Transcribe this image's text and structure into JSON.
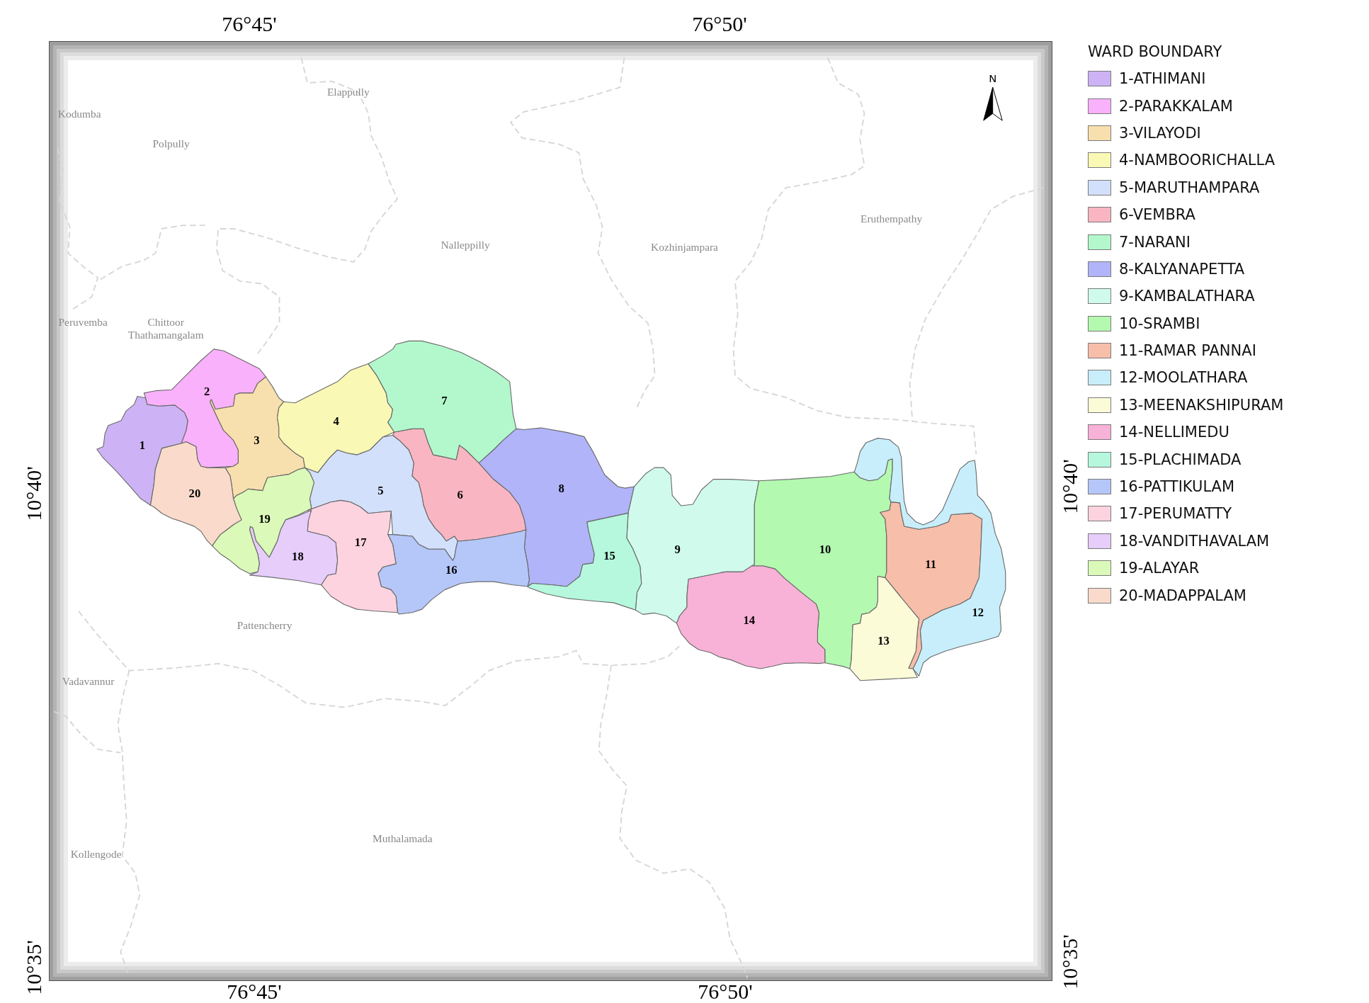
{
  "coordinates": {
    "top": [
      "76°45'",
      "76°50'"
    ],
    "bottom": [
      "76°45'",
      "76°50'"
    ],
    "left": [
      "10°40'",
      "10°35'"
    ],
    "right": [
      "10°40'",
      "10°35'"
    ]
  },
  "map": {
    "places": [
      "Kodumba",
      "Polpully",
      "Elappully",
      "Nalleppilly",
      "Kozhinjampara",
      "Eruthempathy",
      "Peruvemba",
      "Chittoor Thathamangalam",
      "Pattencherry",
      "Vadavannur",
      "Kollengode",
      "Muthalamada"
    ],
    "north_arrow": {
      "label": "N"
    },
    "wards": [
      {
        "label": "1",
        "color": "#cdb3f5"
      },
      {
        "label": "2",
        "color": "#f9b1fb"
      },
      {
        "label": "3",
        "color": "#f8dfae"
      },
      {
        "label": "4",
        "color": "#faf8b5"
      },
      {
        "label": "5",
        "color": "#d3e0fb"
      },
      {
        "label": "6",
        "color": "#f9b6c2"
      },
      {
        "label": "7",
        "color": "#b3f8cc"
      },
      {
        "label": "8",
        "color": "#b1b4f9"
      },
      {
        "label": "9",
        "color": "#d0fbec"
      },
      {
        "label": "10",
        "color": "#b3f9b0"
      },
      {
        "label": "11",
        "color": "#f7beaa"
      },
      {
        "label": "12",
        "color": "#c8eefb"
      },
      {
        "label": "13",
        "color": "#fcfbd8"
      },
      {
        "label": "14",
        "color": "#f8b1d7"
      },
      {
        "label": "15",
        "color": "#b5f8dd"
      },
      {
        "label": "16",
        "color": "#b5c6f8"
      },
      {
        "label": "17",
        "color": "#fcd3df"
      },
      {
        "label": "18",
        "color": "#e6cdfa"
      },
      {
        "label": "19",
        "color": "#dbf9b8"
      },
      {
        "label": "20",
        "color": "#f9dacb"
      }
    ]
  },
  "legend": {
    "title": "WARD BOUNDARY",
    "items": [
      {
        "label": "1-ATHIMANI",
        "color": "#cdb3f5"
      },
      {
        "label": "2-PARAKKALAM",
        "color": "#f9b1fb"
      },
      {
        "label": "3-VILAYODI",
        "color": "#f8dfae"
      },
      {
        "label": "4-NAMBOORICHALLA",
        "color": "#faf8b5"
      },
      {
        "label": "5-MARUTHAMPARA",
        "color": "#d3e0fb"
      },
      {
        "label": "6-VEMBRA",
        "color": "#f9b6c2"
      },
      {
        "label": "7-NARANI",
        "color": "#b3f8cc"
      },
      {
        "label": "8-KALYANAPETTA",
        "color": "#b1b4f9"
      },
      {
        "label": "9-KAMBALATHARA",
        "color": "#d0fbec"
      },
      {
        "label": "10-SRAMBI",
        "color": "#b3f9b0"
      },
      {
        "label": "11-RAMAR PANNAI",
        "color": "#f7beaa"
      },
      {
        "label": "12-MOOLATHARA",
        "color": "#c8eefb"
      },
      {
        "label": "13-MEENAKSHIPURAM",
        "color": "#fcfbd8"
      },
      {
        "label": "14-NELLIMEDU",
        "color": "#f8b1d7"
      },
      {
        "label": "15-PLACHIMADA",
        "color": "#b5f8dd"
      },
      {
        "label": "16-PATTIKULAM",
        "color": "#b5c6f8"
      },
      {
        "label": "17-PERUMATTY",
        "color": "#fcd3df"
      },
      {
        "label": "18-VANDITHAVALAM",
        "color": "#e6cdfa"
      },
      {
        "label": "19-ALAYAR",
        "color": "#dbf9b8"
      },
      {
        "label": "20-MADAPPALAM",
        "color": "#f9dacb"
      }
    ]
  }
}
